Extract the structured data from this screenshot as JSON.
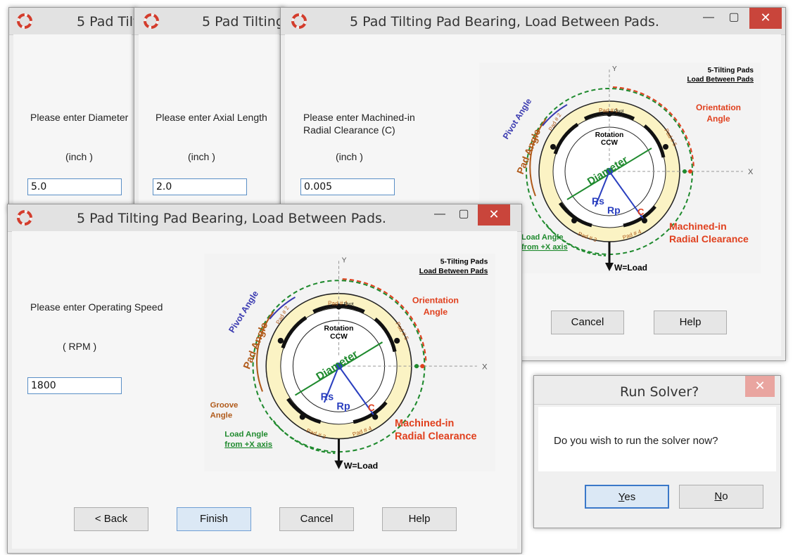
{
  "win1": {
    "title": "5 Pad Tilt",
    "prompt": "Please enter Diameter",
    "unit": "(inch )",
    "value": "5.0"
  },
  "win2": {
    "title": "5 Pad Tilting",
    "prompt": "Please enter Axial Length",
    "unit": "(inch )",
    "value": "2.0"
  },
  "win3": {
    "title": "5 Pad Tilting Pad Bearing, Load Between Pads.",
    "prompt_line1": "Please enter Machined-in",
    "prompt_line2": "Radial Clearance (C)",
    "unit": "(inch )",
    "value": "0.005",
    "cancel": "Cancel",
    "help": "Help"
  },
  "win4": {
    "title": "5 Pad Tilting Pad Bearing, Load Between Pads.",
    "prompt": "Please enter Operating Speed",
    "unit": "( RPM )",
    "value": "1800",
    "back": "< Back",
    "finish": "Finish",
    "cancel": "Cancel",
    "help": "Help"
  },
  "dialog": {
    "title": "Run Solver?",
    "message": "Do you wish to run the solver now?",
    "yes_pre": "",
    "yes_key": "Y",
    "yes_post": "es",
    "no_pre": "",
    "no_key": "N",
    "no_post": "o"
  },
  "diagram": {
    "heading1": "5-Tilting Pads",
    "heading2": "Load Between Pads",
    "pivot_angle": "Pivot Angle",
    "pad_angle": "Pad Angle",
    "orientation1": "Orientation",
    "orientation2": "Angle",
    "rotation1": "Rotation",
    "rotation2": "CCW",
    "diameter": "Diameter",
    "rs": "Rs",
    "rp": "Rp",
    "c": "C",
    "groove1": "Groove",
    "groove2": "Angle",
    "load1": "Load Angle",
    "load2": "from +X axis",
    "mach1": "Machined-in",
    "mach2": "Radial Clearance",
    "wload": "W=Load",
    "x": "X",
    "y": "Y",
    "pad1": "Pad # 1",
    "pad2": "Pad # 2",
    "pad3": "Pad # 3",
    "pad4": "Pad # 4",
    "pad5": "Pad # 5",
    "pivot": "Pivot"
  },
  "colors": {
    "close": "#c9453b",
    "diameter": "#1f8a2e",
    "rsrp": "#2a3fbf",
    "red_label": "#e0401e",
    "pad_label": "#b05a1a",
    "pivot_label": "#3a3ab0",
    "ring_fill": "#fbf3c4"
  }
}
